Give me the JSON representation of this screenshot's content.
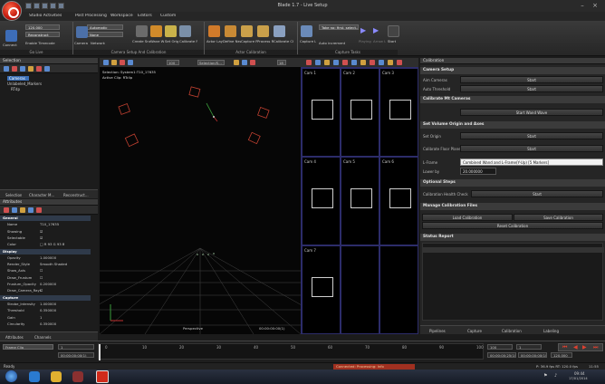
{
  "window": {
    "title": "Blade 1.7 - Live Setup"
  },
  "ribbon_tabs": [
    "Studio Activities",
    "Post Processing",
    "Workspace",
    "Editors",
    "Custom"
  ],
  "ribbon": {
    "connect": {
      "top_dropdown": "120.000",
      "second_dropdown": "Reconstruct",
      "connect_label": "Connect",
      "enable_label": "Enable Timecode",
      "group_label": "Go Live"
    },
    "camera_setup": {
      "dropdown_1": "Automatic",
      "dropdown_2": "None",
      "camera_label": "Camera Layout",
      "network_label": "Network",
      "create_label": "Create Snapshots",
      "wand_label": "Wave Wand",
      "set_label": "Set Origin",
      "calibrate_label": "Calibrate Floor",
      "group_label": "Camera Setup And Calibration"
    },
    "actor_calibration": {
      "actor_label": "Actor Layout",
      "define_new_label": "Define New Actor",
      "capture_rom_label": "Capture ROM",
      "process_rom_label": "Process ROM",
      "calibrate_label": "Calibrate Character",
      "group_label": "Actor Calibration"
    },
    "capture_tasks": {
      "capture_label": "Capture Layout",
      "auto_increment_label": "Auto increment",
      "take_dropdown": "Take no: first, select...",
      "group_label": "Capture Tasks",
      "playing_label": "Playing Live",
      "arrow_label": "Arrow Live",
      "start_label": "Start"
    }
  },
  "left_panel": {
    "selection_header": "Selection",
    "tree": [
      {
        "label": "Cameras",
        "selected": true
      },
      {
        "label": "Unlabeled_Markers",
        "selected": false
      },
      {
        "label": "RTdp",
        "selected": false
      }
    ],
    "tabs": [
      "Selection",
      "Character M...",
      "Reconstruct..."
    ],
    "attributes_header": "Attributes",
    "attributes": [
      {
        "cat": "General"
      },
      {
        "k": "Name",
        "v": "T10_17635"
      },
      {
        "k": "Showing",
        "v": "☑"
      },
      {
        "k": "Selectable",
        "v": "☑"
      },
      {
        "k": "Color",
        "v": "□ R 93 G 93 B"
      },
      {
        "cat": "Display"
      },
      {
        "k": "Opacity",
        "v": "1.000000"
      },
      {
        "k": "Render_Style",
        "v": "Smooth Shaded"
      },
      {
        "k": "Show_Axis",
        "v": "☐"
      },
      {
        "k": "Draw_Frustum",
        "v": "☐"
      },
      {
        "k": "Frustum_Opacity",
        "v": "0.200000"
      },
      {
        "k": "Draw_Camera_Rays",
        "v": "☐"
      },
      {
        "cat": "Capture"
      },
      {
        "k": "Strobe_Intensity",
        "v": "1.000000"
      },
      {
        "k": "Threshold",
        "v": "0.350000"
      },
      {
        "k": "Gain",
        "v": "1"
      },
      {
        "k": "Circularity",
        "v": "0.350000"
      }
    ],
    "bottom_tabs": [
      "Attributes",
      "Channels"
    ]
  },
  "viewport": {
    "selection_text": "Selection: System1:T10_17635",
    "active_clip_text": "Active Clip: RTclip",
    "label": "Perspective",
    "timecode": "00:00:00:00(1)",
    "zoom_value": "100",
    "dropdown": "Selection/S...",
    "toolbar_number": "18"
  },
  "cameras": [
    {
      "label": "Cam 1",
      "has_box": true
    },
    {
      "label": "Cam 2",
      "has_box": true
    },
    {
      "label": "Cam 3",
      "has_box": true
    },
    {
      "label": "Cam 4",
      "has_box": true
    },
    {
      "label": "Cam 5",
      "has_box": true
    },
    {
      "label": "Cam 6",
      "has_box": true
    },
    {
      "label": "Cam 7",
      "has_box": true
    },
    {
      "label": "",
      "has_box": false
    },
    {
      "label": "",
      "has_box": false
    }
  ],
  "calibration": {
    "header": "Calibration",
    "camera_setup_title": "Camera Setup",
    "aim_cameras_label": "Aim Cameras",
    "auto_threshold_label": "Auto Threshold",
    "start_label": "Start",
    "calibrate_title": "Calibrate Mt Cameras",
    "start_wand_wave_label": "Start Wand Wave",
    "set_volume_title": "Set Volume Origin and Axes",
    "set_origin_label": "Set Origin",
    "calibrate_floor_label": "Calibrate Floor Plane",
    "lframe_label": "L-Frame",
    "lframe_value": "Combined Wand and L-Frame(Y-Up) [5 Markers]",
    "lower_by_label": "Lower by",
    "lower_by_value": "20.000000",
    "optional_title": "Optional Steps",
    "health_check_label": "Calibration Health Check",
    "manage_title": "Manage Calibration Files",
    "load_label": "Load Calibration",
    "save_label": "Save Calibration",
    "reset_label": "Reset Calibration",
    "status_title": "Status Report",
    "bottom_tabs": [
      "Pipelines",
      "Capture",
      "Calibration",
      "Labeling"
    ]
  },
  "timeline": {
    "frame_range_label": "Frame Clip",
    "start_value": "1",
    "start_tc": "00:00:00:00(1)",
    "ticks": [
      "0",
      "10",
      "20",
      "30",
      "40",
      "50",
      "60",
      "70",
      "80",
      "90",
      "100"
    ],
    "end_value": "100",
    "end_value2": "1",
    "end_tc": "00:00:00:25(1)",
    "end_tc2": "00:00:00:00(1)",
    "fps": "120.000"
  },
  "status": {
    "ready": "Ready",
    "processing": "Connected: Processing: Info",
    "fps_text": "P: 36.9 fps  RT: 120.0 fps",
    "clock": "11:55",
    "tray_time": "09:44",
    "tray_date": "17/01/2014"
  },
  "colors": {
    "accent": "#c0150a",
    "selection": "#3b6fb6",
    "camera_border": "#2c2c6a"
  }
}
